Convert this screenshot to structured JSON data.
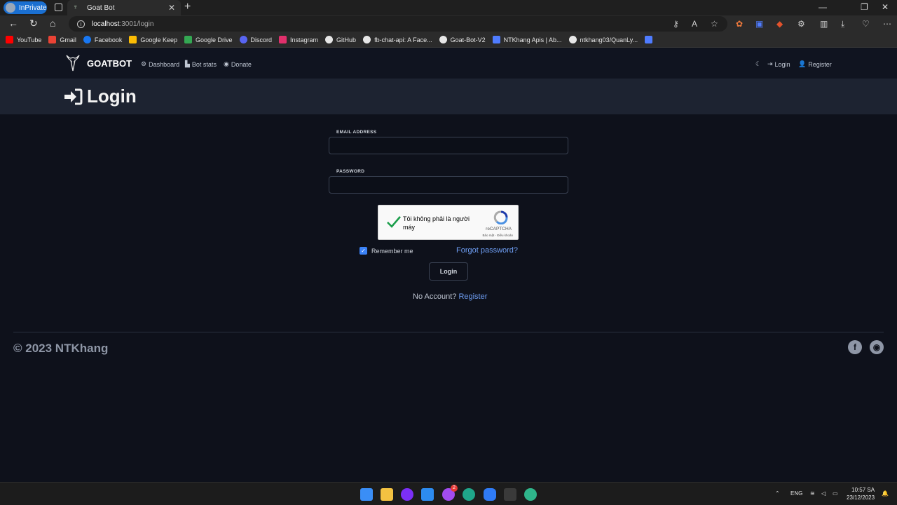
{
  "browser": {
    "profile_label": "InPrivate",
    "tab_title": "Goat Bot",
    "url_host": "localhost",
    "url_path": ":3001/login"
  },
  "bookmarks": [
    {
      "label": "YouTube",
      "color": "#ff0000"
    },
    {
      "label": "Gmail",
      "color": "#ea4335"
    },
    {
      "label": "Facebook",
      "color": "#1877f2"
    },
    {
      "label": "Google Keep",
      "color": "#fbbc04"
    },
    {
      "label": "Google Drive",
      "color": "#34a853"
    },
    {
      "label": "Discord",
      "color": "#5865f2"
    },
    {
      "label": "Instagram",
      "color": "#e1306c"
    },
    {
      "label": "GitHub",
      "color": "#e6e6e6"
    },
    {
      "label": "fb-chat-api: A Face...",
      "color": "#e6e6e6"
    },
    {
      "label": "Goat-Bot-V2",
      "color": "#e6e6e6"
    },
    {
      "label": "NTKhang Apis | Ab...",
      "color": "#4f7cff"
    },
    {
      "label": "ntkhang03/QuanLy...",
      "color": "#e6e6e6"
    }
  ],
  "site": {
    "brand": "GOATBOT",
    "nav_dashboard": "Dashboard",
    "nav_botstats": "Bot stats",
    "nav_donate": "Donate",
    "nav_login": "Login",
    "nav_register": "Register",
    "page_title": "Login"
  },
  "form": {
    "email_label": "EMAIL ADDRESS",
    "email_value": "",
    "password_label": "PASSWORD",
    "password_value": "",
    "captcha_text": "Tôi không phải là người máy",
    "captcha_brand": "reCAPTCHA",
    "captcha_terms": "Bảo mật - Điều khoản",
    "remember_label": "Remember me",
    "remember_checked": true,
    "forgot_label": "Forgot password?",
    "submit_label": "Login",
    "no_account_text": "No Account?",
    "register_link": "Register"
  },
  "footer": {
    "copyright": "© 2023 NTKhang"
  },
  "taskbar": {
    "lang": "ENG",
    "time": "10:57 SA",
    "date": "23/12/2023",
    "messenger_badge": "2"
  }
}
